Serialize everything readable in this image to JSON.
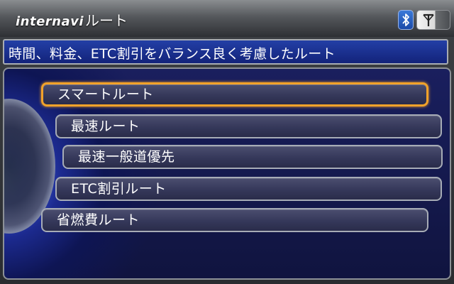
{
  "header": {
    "brand": "internavi",
    "title_suffix": "ルート",
    "bluetooth_icon": "bluetooth-icon",
    "signal_icon": "antenna-signal-icon"
  },
  "banner": {
    "text": "時間、料金、ETC割引をバランス良く考慮したルート"
  },
  "menu": {
    "items": [
      {
        "label": "スマートルート",
        "selected": true
      },
      {
        "label": "最速ルート",
        "selected": false
      },
      {
        "label": "最速一般道優先",
        "selected": false
      },
      {
        "label": "ETC割引ルート",
        "selected": false
      },
      {
        "label": "省燃費ルート",
        "selected": false
      }
    ]
  },
  "colors": {
    "selection": "#f2a22a",
    "banner": "#1a2f8f",
    "panel": "#10143f"
  }
}
